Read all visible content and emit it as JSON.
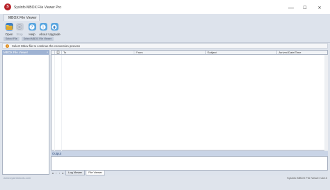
{
  "window": {
    "title": "SysInfo MBOX File Viewer Pro",
    "logo_letter": "S",
    "controls": [
      "—",
      "☐",
      "✕"
    ]
  },
  "ribbon": {
    "tab_label": "MBOX File Viewer",
    "buttons": [
      {
        "label": "Open",
        "icon": "open-icon"
      },
      {
        "label": "Stop",
        "icon": "stop-icon"
      },
      {
        "label": "Help",
        "icon": "help-icon"
      },
      {
        "label": "About",
        "icon": "about-icon"
      },
      {
        "label": "Upgrade",
        "icon": "upgrade-icon"
      }
    ],
    "groups": [
      "Select File",
      "Select MBOX File Viewer"
    ]
  },
  "infobar": {
    "text": "Select Mbox file to continue the conversion process"
  },
  "left_panel": {
    "title": "MBOX File Viewer",
    "pin": "ᵖ"
  },
  "grid": {
    "columns": [
      "",
      "",
      "To",
      "From",
      "Subject",
      "Arrived Date/Time"
    ]
  },
  "output": {
    "title": "Output"
  },
  "view_tabs": {
    "tabs": [
      "Log Viewer",
      "File Viewer"
    ],
    "active": "File Viewer"
  },
  "status": {
    "left": "www.sysinfotools.com",
    "right": "SysInfo MBOX File Viewer v18.0"
  },
  "colors": {
    "ribbon_bg": "#dde3ec",
    "panel_header": "#9fb3d3",
    "brand_red": "#b8232a"
  }
}
